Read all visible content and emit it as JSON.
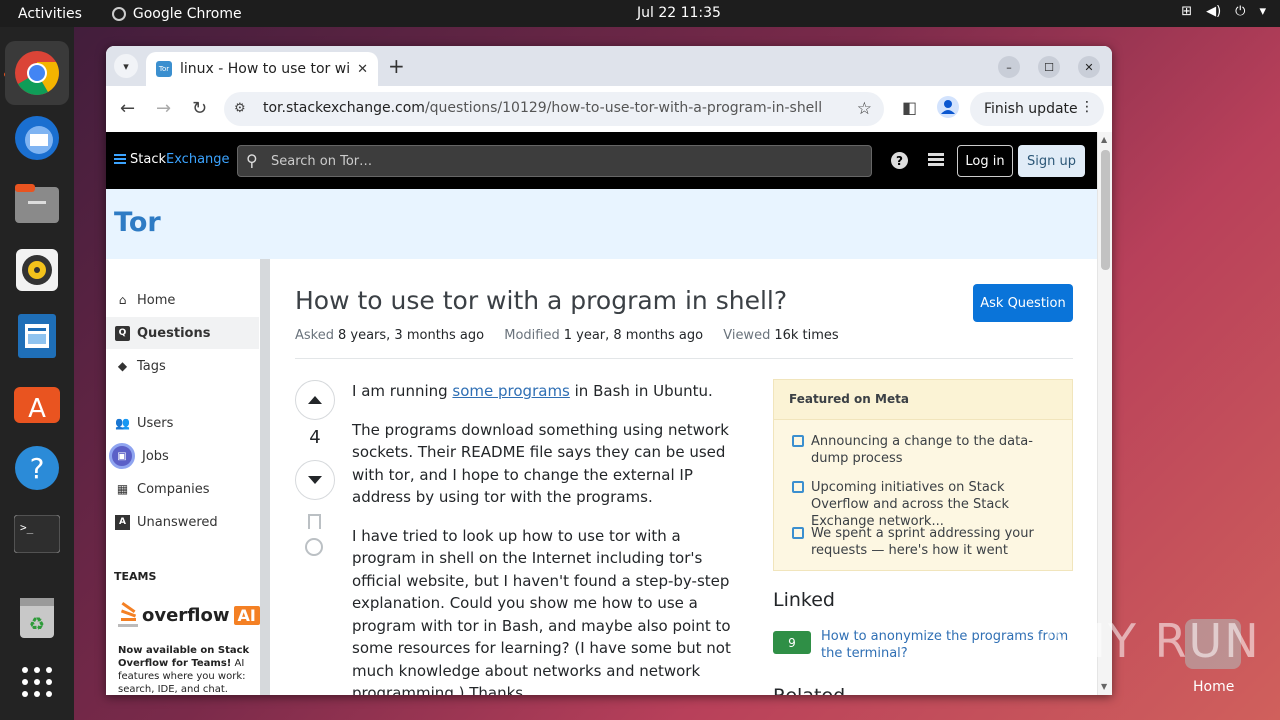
{
  "os": {
    "activities": "Activities",
    "app_name": "Google Chrome",
    "clock": "Jul 22  11:35",
    "dock_items": [
      "chrome-icon",
      "thunderbird-icon",
      "files-icon",
      "rhythmbox-icon",
      "writer-icon",
      "appstore-icon",
      "help-icon",
      "terminal-icon",
      "trash-icon",
      "app-grid-icon"
    ]
  },
  "browser": {
    "tab_title": "linux - How to use tor wit",
    "tab_favicon": "Tor",
    "url_host": "tor.stackexchange.com",
    "url_path": "/questions/10129/how-to-use-tor-with-a-program-in-shell",
    "finish_update": "Finish update"
  },
  "header": {
    "logo_stack": "Stack",
    "logo_exchange": "Exchange",
    "search_placeholder": "Search on Tor…",
    "login": "Log in",
    "signup": "Sign up"
  },
  "site": {
    "name": "Tor"
  },
  "nav": {
    "items": [
      {
        "label": "Home"
      },
      {
        "label": "Questions"
      },
      {
        "label": "Tags"
      },
      {
        "label": "Users"
      },
      {
        "label": "Jobs"
      },
      {
        "label": "Companies"
      },
      {
        "label": "Unanswered"
      }
    ],
    "teams_label": "TEAMS",
    "ofai_word": "overflow",
    "ofai_ai": "AI",
    "teams_bold": "Now available on Stack Overflow for Teams!",
    "teams_text": " AI features where you work: search, IDE, and chat."
  },
  "question": {
    "title": "How to use tor with a program in shell?",
    "ask_button": "Ask Question",
    "asked_label": "Asked",
    "asked_value": "8 years, 3 months ago",
    "modified_label": "Modified",
    "modified_value": "1 year, 8 months ago",
    "viewed_label": "Viewed",
    "viewed_value": "16k times",
    "votes": "4",
    "p1_before": "I am running ",
    "p1_link": "some programs",
    "p1_after": " in Bash in Ubuntu.",
    "p2": "The programs download something using network sockets. Their README file says they can be used with tor, and I hope to change the external IP address by using tor with the programs.",
    "p3": "I have tried to look up how to use tor with a program in shell on the Internet including tor's official website, but I haven't found a step-by-step explanation. Could you show me how to use a program with tor in Bash, and maybe also point to some resources for learning? (I have some but not much knowledge about networks and network programming.) Thanks."
  },
  "sidebar": {
    "meta_title": "Featured on Meta",
    "meta_items": [
      "Announcing a change to the data-dump process",
      "Upcoming initiatives on Stack Overflow and across the Stack Exchange network...",
      "We spent a sprint addressing your requests — here's how it went"
    ],
    "linked_title": "Linked",
    "linked_score": "9",
    "linked_text": "How to anonymize the programs from the terminal?",
    "related_title": "Related"
  },
  "overlay": {
    "watermark": "ANY RUN",
    "home_label": "Home"
  },
  "colors": {
    "accent": "#0a74d9",
    "link": "#2f6fb4",
    "site_banner": "#e8f4ff",
    "meta_box": "#fdf7e2"
  }
}
